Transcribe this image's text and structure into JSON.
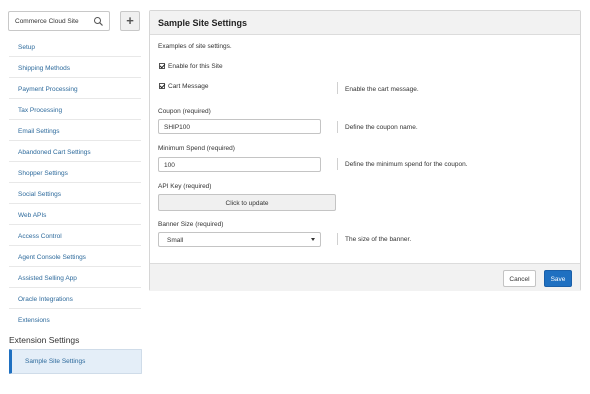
{
  "sidebar": {
    "search": {
      "value": "Commerce Cloud Site",
      "icon": "search-icon"
    },
    "add_button": {
      "label": "+"
    },
    "items": [
      {
        "label": "Setup"
      },
      {
        "label": "Shipping Methods"
      },
      {
        "label": "Payment Processing"
      },
      {
        "label": "Tax Processing"
      },
      {
        "label": "Email Settings"
      },
      {
        "label": "Abandoned Cart Settings"
      },
      {
        "label": "Shopper Settings"
      },
      {
        "label": "Social Settings"
      },
      {
        "label": "Web APIs"
      },
      {
        "label": "Access Control"
      },
      {
        "label": "Agent Console Settings"
      },
      {
        "label": "Assisted Selling App"
      },
      {
        "label": "Oracle Integrations"
      },
      {
        "label": "Extensions"
      }
    ],
    "section_title": "Extension Settings",
    "active_item": {
      "label": "Sample Site Settings"
    }
  },
  "panel": {
    "title": "Sample Site Settings",
    "description": "Examples of site settings.",
    "enable_checkbox": {
      "label": "Enable for this Site",
      "checked": true
    },
    "cart_message": {
      "label": "Cart Message",
      "checked": true,
      "help": "Enable the cart message."
    },
    "coupon": {
      "label": "Coupon (required)",
      "value": "SHIP100",
      "help": "Define the coupon name."
    },
    "minimum_spend": {
      "label": "Minimum Spend (required)",
      "value": "100",
      "help": "Define the minimum spend for the coupon."
    },
    "api_key": {
      "label": "API Key (required)",
      "button": "Click to update"
    },
    "banner_size": {
      "label": "Banner Size (required)",
      "value": "Small",
      "help": "The size of the banner."
    },
    "footer": {
      "cancel": "Cancel",
      "save": "Save"
    }
  },
  "colors": {
    "accent": "#1f70c1",
    "link": "#2d6a9c",
    "active_bg": "#e4eef8",
    "header_bg": "#f2f2f2"
  }
}
